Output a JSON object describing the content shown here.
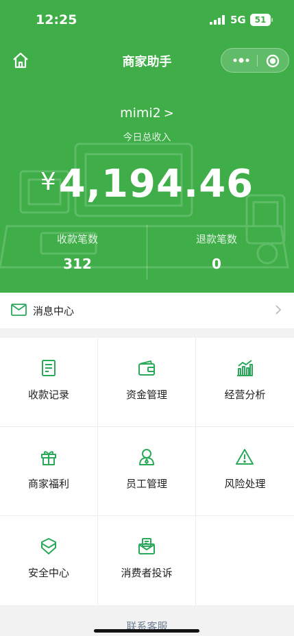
{
  "status_bar": {
    "time": "12:25",
    "network": "5G",
    "battery": "51"
  },
  "nav": {
    "title": "商家助手"
  },
  "merchant": {
    "name": "mimi2",
    "chevron": ">"
  },
  "income": {
    "label": "今日总收入",
    "currency": "¥",
    "amount": "4,194.46"
  },
  "stats": [
    {
      "label": "收款笔数",
      "value": "312"
    },
    {
      "label": "退款笔数",
      "value": "0"
    }
  ],
  "message_center": {
    "label": "消息中心"
  },
  "grid": [
    {
      "label": "收款记录",
      "icon": "receipt-icon"
    },
    {
      "label": "资金管理",
      "icon": "wallet-icon"
    },
    {
      "label": "经营分析",
      "icon": "bar-chart-icon"
    },
    {
      "label": "商家福利",
      "icon": "gift-icon"
    },
    {
      "label": "员工管理",
      "icon": "staff-icon"
    },
    {
      "label": "风险处理",
      "icon": "warning-icon"
    },
    {
      "label": "安全中心",
      "icon": "shield-icon"
    },
    {
      "label": "消费者投诉",
      "icon": "complaint-icon"
    }
  ],
  "footer": {
    "link": "联系客服"
  },
  "colors": {
    "brand": "#3fae49",
    "icon": "#2aa85a",
    "link": "#6e7e93"
  }
}
